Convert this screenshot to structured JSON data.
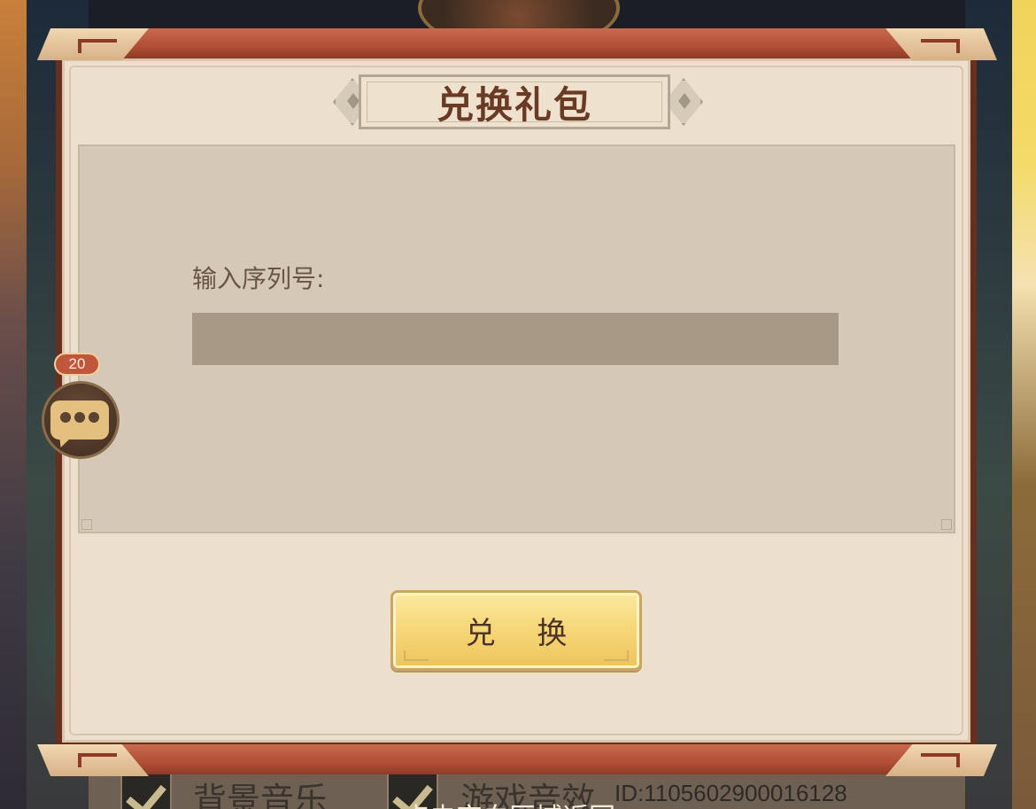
{
  "dialog": {
    "title": "兑换礼包",
    "input_label": "输入序列号:",
    "input_value": "",
    "input_placeholder": "",
    "redeem_label": "兑 换"
  },
  "chat": {
    "badge_count": "20",
    "icon": "chat-bubble-icon"
  },
  "background": {
    "music_label": "背景音乐",
    "sfx_label": "游戏音效",
    "player_id": "ID:1105602900016128",
    "bottom_text": "点击空白区域返回"
  },
  "colors": {
    "frame": "#b14e36",
    "dialog_bg": "#eddfcd",
    "panel_bg": "#d6c8b6",
    "input_bg": "#a89886",
    "button": "#f6d87a",
    "title_text": "#6b3a25",
    "badge": "#c0563b"
  }
}
